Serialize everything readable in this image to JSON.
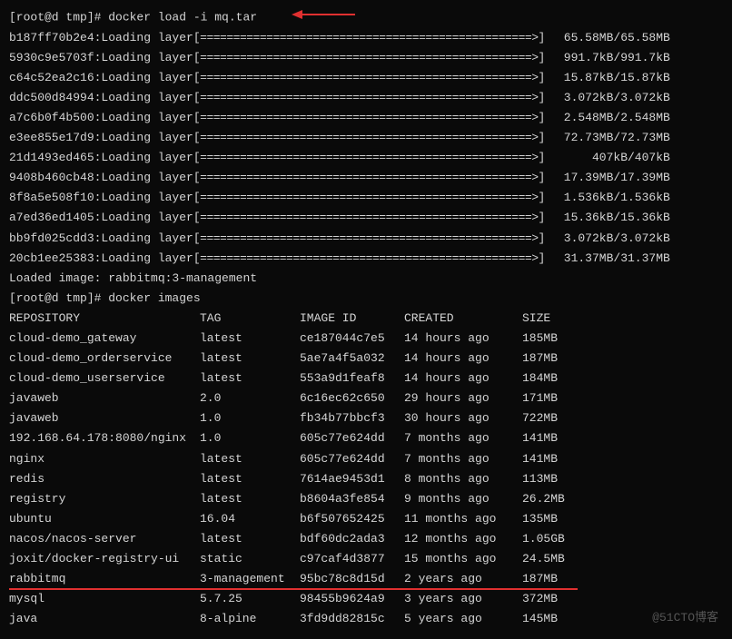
{
  "prompt1": {
    "prefix": "[root@d tmp]# ",
    "command": "docker load -i mq.tar"
  },
  "layers": [
    {
      "hash": "b187ff70b2e4",
      "label": "Loading layer",
      "size": "65.58MB/65.58MB"
    },
    {
      "hash": "5930c9e5703f",
      "label": "Loading layer",
      "size": "991.7kB/991.7kB"
    },
    {
      "hash": "c64c52ea2c16",
      "label": "Loading layer",
      "size": "15.87kB/15.87kB"
    },
    {
      "hash": "ddc500d84994",
      "label": "Loading layer",
      "size": "3.072kB/3.072kB"
    },
    {
      "hash": "a7c6b0f4b500",
      "label": "Loading layer",
      "size": "2.548MB/2.548MB"
    },
    {
      "hash": "e3ee855e17d9",
      "label": "Loading layer",
      "size": "72.73MB/72.73MB"
    },
    {
      "hash": "21d1493ed465",
      "label": "Loading layer",
      "size": "407kB/407kB"
    },
    {
      "hash": "9408b460cb48",
      "label": "Loading layer",
      "size": "17.39MB/17.39MB"
    },
    {
      "hash": "8f8a5e508f10",
      "label": "Loading layer",
      "size": "1.536kB/1.536kB"
    },
    {
      "hash": "a7ed36ed1405",
      "label": "Loading layer",
      "size": "15.36kB/15.36kB"
    },
    {
      "hash": "bb9fd025cdd3",
      "label": "Loading layer",
      "size": "3.072kB/3.072kB"
    },
    {
      "hash": "20cb1ee25383",
      "label": "Loading layer",
      "size": "31.37MB/31.37MB"
    }
  ],
  "loaded_image": "Loaded image: rabbitmq:3-management",
  "prompt2": {
    "prefix": "[root@d tmp]# ",
    "command": "docker images"
  },
  "headers": {
    "repository": "REPOSITORY",
    "tag": "TAG",
    "image_id": "IMAGE ID",
    "created": "CREATED",
    "size": "SIZE"
  },
  "images": [
    {
      "repo": "cloud-demo_gateway",
      "tag": "latest",
      "id": "ce187044c7e5",
      "created": "14 hours ago",
      "size": "185MB"
    },
    {
      "repo": "cloud-demo_orderservice",
      "tag": "latest",
      "id": "5ae7a4f5a032",
      "created": "14 hours ago",
      "size": "187MB"
    },
    {
      "repo": "cloud-demo_userservice",
      "tag": "latest",
      "id": "553a9d1feaf8",
      "created": "14 hours ago",
      "size": "184MB"
    },
    {
      "repo": "javaweb",
      "tag": "2.0",
      "id": "6c16ec62c650",
      "created": "29 hours ago",
      "size": "171MB"
    },
    {
      "repo": "javaweb",
      "tag": "1.0",
      "id": "fb34b77bbcf3",
      "created": "30 hours ago",
      "size": "722MB"
    },
    {
      "repo": "192.168.64.178:8080/nginx",
      "tag": "1.0",
      "id": "605c77e624dd",
      "created": "7 months ago",
      "size": "141MB"
    },
    {
      "repo": "nginx",
      "tag": "latest",
      "id": "605c77e624dd",
      "created": "7 months ago",
      "size": "141MB"
    },
    {
      "repo": "redis",
      "tag": "latest",
      "id": "7614ae9453d1",
      "created": "8 months ago",
      "size": "113MB"
    },
    {
      "repo": "registry",
      "tag": "latest",
      "id": "b8604a3fe854",
      "created": "9 months ago",
      "size": "26.2MB"
    },
    {
      "repo": "ubuntu",
      "tag": "16.04",
      "id": "b6f507652425",
      "created": "11 months ago",
      "size": "135MB"
    },
    {
      "repo": "nacos/nacos-server",
      "tag": "latest",
      "id": "bdf60dc2ada3",
      "created": "12 months ago",
      "size": "1.05GB"
    },
    {
      "repo": "joxit/docker-registry-ui",
      "tag": "static",
      "id": "c97caf4d3877",
      "created": "15 months ago",
      "size": "24.5MB"
    },
    {
      "repo": "rabbitmq",
      "tag": "3-management",
      "id": "95bc78c8d15d",
      "created": "2 years ago",
      "size": "187MB"
    },
    {
      "repo": "mysql",
      "tag": "5.7.25",
      "id": "98455b9624a9",
      "created": "3 years ago",
      "size": "372MB"
    },
    {
      "repo": "java",
      "tag": "8-alpine",
      "id": "3fd9dd82815c",
      "created": "5 years ago",
      "size": "145MB"
    }
  ],
  "progress_bar": "[==================================================>]",
  "watermark": "@51CTO博客"
}
